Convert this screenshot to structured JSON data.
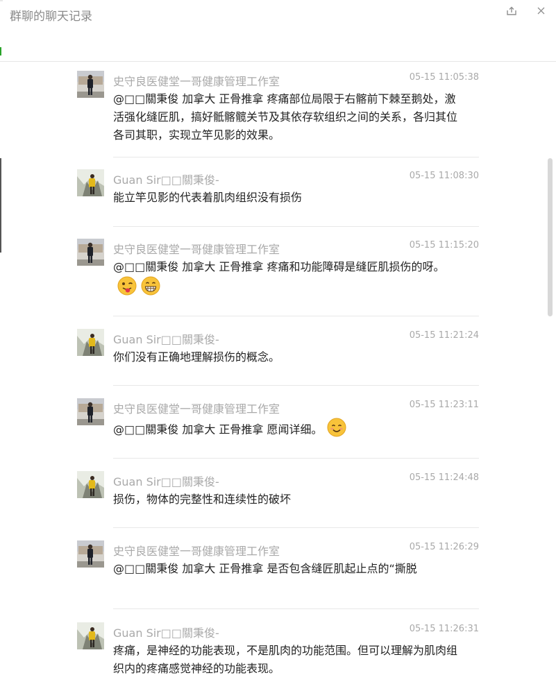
{
  "window": {
    "title": "群聊的聊天记录",
    "share_icon": "share-icon",
    "close_icon": "close-icon"
  },
  "messages": [
    {
      "avatar": "avatar-shi",
      "sender": "史守良医健堂一哥健康管理工作室",
      "time": "05-15 11:05:38",
      "text": "@□□關秉俊 加拿大 正骨推拿 疼痛部位局限于右髂前下棘至鹅处，激活强化缝匠肌，搞好骶髂髋关节及其依存软组织之间的关系，各归其位各司其职，实现立竿见影的效果。",
      "emojis": []
    },
    {
      "avatar": "avatar-guan",
      "sender": "Guan Sir□□關秉俊-",
      "time": "05-15 11:08:30",
      "text": "能立竿见影的代表着肌肉组织没有损伤",
      "emojis": []
    },
    {
      "avatar": "avatar-shi",
      "sender": "史守良医健堂一哥健康管理工作室",
      "time": "05-15 11:15:20",
      "text": "@□□關秉俊 加拿大 正骨推拿 疼痛和功能障碍是缝匠肌损伤的呀。",
      "emojis": [
        "winking-tongue-emoji",
        "grinning-emoji"
      ]
    },
    {
      "avatar": "avatar-guan",
      "sender": "Guan Sir□□關秉俊-",
      "time": "05-15 11:21:24",
      "text": "你们没有正确地理解损伤的概念。",
      "emojis": []
    },
    {
      "avatar": "avatar-shi",
      "sender": "史守良医健堂一哥健康管理工作室",
      "time": "05-15 11:23:11",
      "text": "@□□關秉俊 加拿大 正骨推拿 愿闻详细。",
      "emojis": [
        "smiling-emoji"
      ]
    },
    {
      "avatar": "avatar-guan",
      "sender": "Guan Sir□□關秉俊-",
      "time": "05-15 11:24:48",
      "text": "损伤，物体的完整性和连续性的破坏",
      "emojis": []
    },
    {
      "avatar": "avatar-shi",
      "sender": "史守良医健堂一哥健康管理工作室",
      "time": "05-15 11:26:29",
      "text": "@□□關秉俊 加拿大 正骨推拿 是否包含缝匠肌起止点的“撕脱",
      "emojis": []
    },
    {
      "avatar": "avatar-guan",
      "sender": "Guan Sir□□關秉俊-",
      "time": "05-15 11:26:31",
      "text": "疼痛，是神经的功能表现，不是肌肉的功能范围。但可以理解为肌肉组织内的疼痛感觉神经的功能表现。",
      "emojis": []
    }
  ]
}
